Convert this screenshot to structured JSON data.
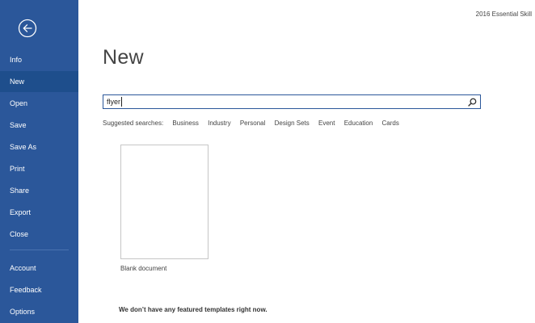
{
  "window": {
    "title": "2016 Essential Skill"
  },
  "sidebar": {
    "back_icon": "back-arrow-icon",
    "items": [
      {
        "label": "Info"
      },
      {
        "label": "New"
      },
      {
        "label": "Open"
      },
      {
        "label": "Save"
      },
      {
        "label": "Save As"
      },
      {
        "label": "Print"
      },
      {
        "label": "Share"
      },
      {
        "label": "Export"
      },
      {
        "label": "Close"
      },
      {
        "label": "Account"
      },
      {
        "label": "Feedback"
      },
      {
        "label": "Options"
      }
    ],
    "active_item": "New"
  },
  "main": {
    "title": "New",
    "search": {
      "value": "flyer",
      "icon": "search-icon"
    },
    "suggested": {
      "label": "Suggested searches:",
      "items": [
        "Business",
        "Industry",
        "Personal",
        "Design Sets",
        "Event",
        "Education",
        "Cards"
      ]
    },
    "blank_document_label": "Blank document",
    "no_templates_message": "We don’t have any featured templates right now."
  },
  "colors": {
    "sidebar_bg": "#2b579a",
    "sidebar_active": "#1e4e8c",
    "accent": "#2b579a"
  }
}
